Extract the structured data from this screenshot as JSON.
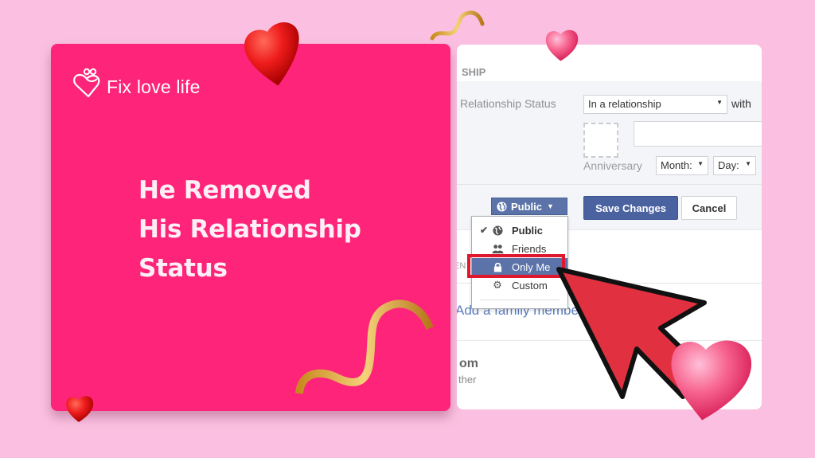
{
  "brand": {
    "logo_text": "Fix love life",
    "accent_color": "#fe2479",
    "background_color": "#fbc0e1"
  },
  "headline": {
    "lines": [
      "He Removed",
      "His Relationship",
      "Status"
    ]
  },
  "facebook_panel": {
    "section_title": "SHIP",
    "relationship_label": "Relationship Status",
    "relationship_value": "In a relationship",
    "with_label": "with",
    "partner_input_value": "",
    "anniversary_label": "Anniversary",
    "month_select": "Month:",
    "day_select": "Day:",
    "privacy_button": "Public",
    "save_button": "Save Changes",
    "cancel_button": "Cancel",
    "family_section_hint": "EN",
    "add_family_link": "Add a family member",
    "from_label": "om",
    "other_label": "ther",
    "primary_color": "#4a62a0"
  },
  "privacy_dropdown": {
    "items": [
      {
        "label": "Public",
        "icon": "globe-icon",
        "checked": true
      },
      {
        "label": "Friends",
        "icon": "friends-icon",
        "checked": false
      },
      {
        "label": "Only Me",
        "icon": "lock-icon",
        "checked": false,
        "highlighted": true
      },
      {
        "label": "Custom",
        "icon": "gear-icon",
        "checked": false
      }
    ],
    "highlight_color": "#e0182d"
  }
}
